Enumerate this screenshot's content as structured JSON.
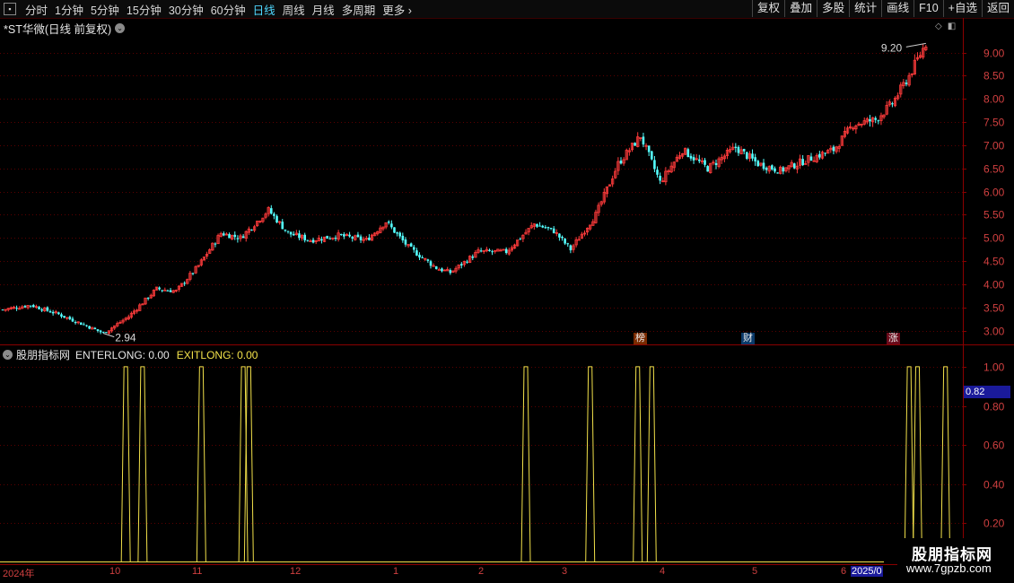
{
  "toolbar": {
    "periods": [
      "分时",
      "1分钟",
      "5分钟",
      "15分钟",
      "30分钟",
      "60分钟",
      "日线",
      "周线",
      "月线",
      "多周期",
      "更多"
    ],
    "active_period": "日线",
    "right_buttons": [
      "复权",
      "叠加",
      "多股",
      "统计",
      "画线",
      "F10",
      "+自选",
      "返回"
    ]
  },
  "main_chart": {
    "title": "*ST华微(日线 前复权)",
    "y_ticks": [
      "9.00",
      "8.50",
      "8.00",
      "7.50",
      "7.00",
      "6.50",
      "6.00",
      "5.50",
      "5.00",
      "4.50",
      "4.00",
      "3.50",
      "3.00"
    ],
    "high_label": "9.20",
    "low_label": "2.94",
    "badges": {
      "bang": "榜",
      "cai": "财",
      "zhang": "涨"
    },
    "up_color": "#ff3b3b",
    "down_color": "#54ffff"
  },
  "indicator": {
    "name": "股朋指标网",
    "enterlong_label": "ENTERLONG: 0.00",
    "exitlong_label": "EXITLONG: 0.00",
    "y_ticks": [
      "1.00",
      "0.80",
      "0.60",
      "0.40",
      "0.20"
    ],
    "cursor_value": "0.82",
    "signal_color": "#f2e14a"
  },
  "date_axis": {
    "labels": [
      "2024年",
      "10",
      "11",
      "12",
      "1",
      "2",
      "3",
      "4",
      "5",
      "6"
    ],
    "current": "2025/0"
  },
  "watermark": {
    "name": "股朋指标网",
    "url": "www.7gpzb.com"
  },
  "chart_data": {
    "type": "candlestick",
    "title": "*ST华微(日线 前复权)",
    "ylim": [
      2.7,
      9.4
    ],
    "y_ticks": [
      3.0,
      3.5,
      4.0,
      4.5,
      5.0,
      5.5,
      6.0,
      6.5,
      7.0,
      7.5,
      8.0,
      8.5,
      9.0
    ],
    "annotated_low": 2.94,
    "annotated_high": 9.2,
    "close_trend": [
      [
        0,
        3.45
      ],
      [
        10,
        3.55
      ],
      [
        20,
        3.35
      ],
      [
        30,
        3.1
      ],
      [
        36,
        2.94
      ],
      [
        45,
        3.3
      ],
      [
        55,
        3.9
      ],
      [
        62,
        3.85
      ],
      [
        70,
        4.4
      ],
      [
        78,
        5.1
      ],
      [
        85,
        5.0
      ],
      [
        95,
        5.6
      ],
      [
        102,
        5.1
      ],
      [
        110,
        4.95
      ],
      [
        120,
        5.05
      ],
      [
        130,
        4.95
      ],
      [
        137,
        5.35
      ],
      [
        145,
        4.8
      ],
      [
        155,
        4.35
      ],
      [
        160,
        4.25
      ],
      [
        170,
        4.7
      ],
      [
        180,
        4.7
      ],
      [
        190,
        5.3
      ],
      [
        197,
        5.15
      ],
      [
        203,
        4.75
      ],
      [
        212,
        5.5
      ],
      [
        220,
        6.6
      ],
      [
        228,
        7.2
      ],
      [
        235,
        6.2
      ],
      [
        243,
        6.9
      ],
      [
        252,
        6.5
      ],
      [
        262,
        6.95
      ],
      [
        270,
        6.6
      ],
      [
        278,
        6.45
      ],
      [
        288,
        6.7
      ],
      [
        297,
        6.9
      ],
      [
        304,
        7.45
      ],
      [
        312,
        7.55
      ],
      [
        318,
        7.9
      ],
      [
        324,
        8.5
      ],
      [
        330,
        9.2
      ]
    ],
    "indicator_ylim": [
      0,
      1.05
    ],
    "indicator_signals_x": [
      44,
      50,
      71,
      86,
      88,
      187,
      210,
      227,
      232,
      324,
      327,
      337
    ]
  }
}
